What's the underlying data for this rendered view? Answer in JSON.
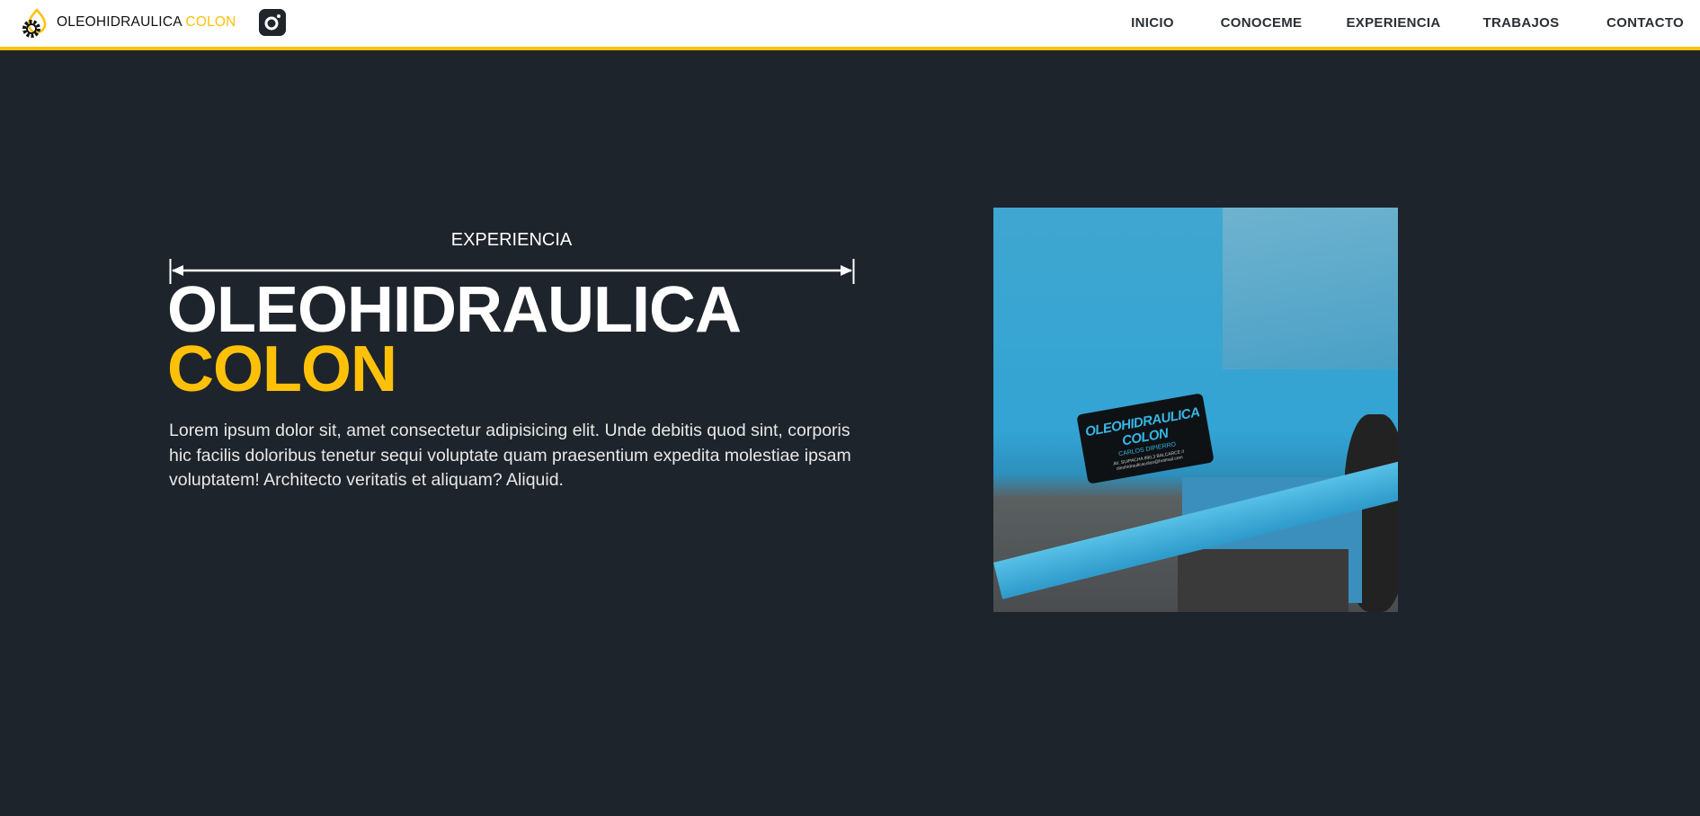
{
  "header": {
    "brand_main": "OLEOHIDRAULICA",
    "brand_accent": "COLON",
    "logo_icon": "oil-drop-gear-icon",
    "social_icon": "instagram-icon",
    "nav": [
      "INICIO",
      "CONOCEME",
      "EXPERIENCIA",
      "TRABAJOS",
      "CONTACTO"
    ]
  },
  "hero": {
    "section_label": "EXPERIENCIA",
    "title_main": "OLEOHIDRAULICA",
    "title_accent": "COLON",
    "description": "Lorem ipsum dolor sit, amet consectetur adipisicing elit. Unde debitis quod sint, corporis hic facilis doloribus tenetur sequi voluptate quam praesentium expedita molestiae ipsam voluptatem! Architecto veritatis et aliquam? Aliquid.",
    "photo": {
      "sticker_title": "OLEOHIDRAULICA COLON",
      "sticker_name": "CARLOS DIPIERRO",
      "sticker_address": "AV. SUIPACHA 890,3 BALCARCE // oleohidraulicacolon@hotmail.com"
    }
  },
  "colors": {
    "accent": "#ffc107",
    "background": "#1e242b",
    "nav_bg": "#ffffff"
  }
}
